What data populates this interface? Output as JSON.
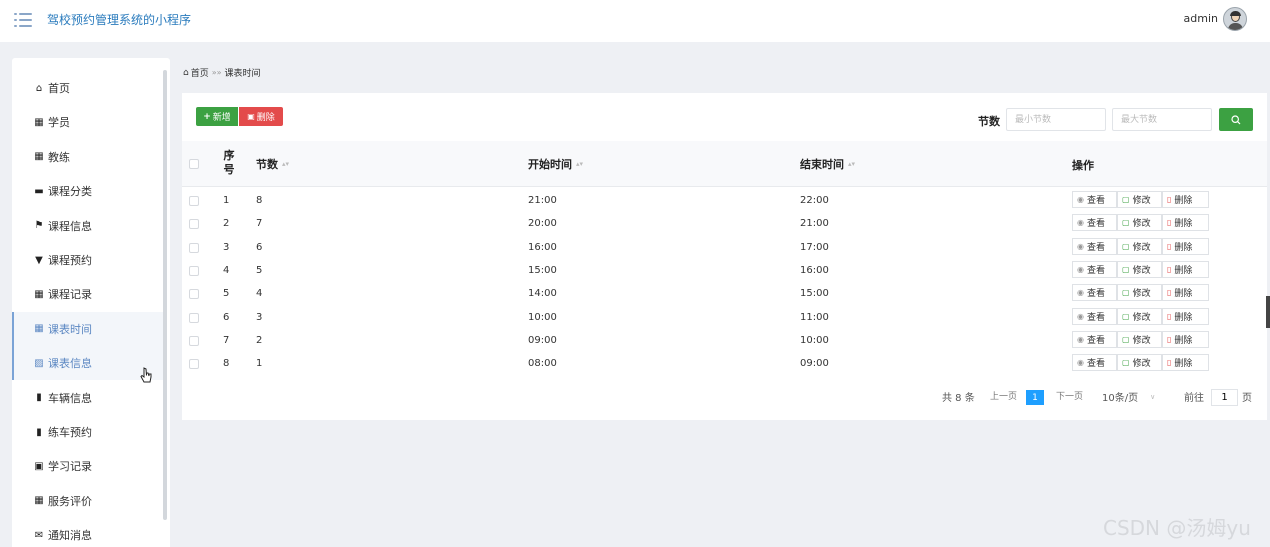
{
  "header": {
    "app_title": "驾校预约管理系统的小程序",
    "user_name": "admin"
  },
  "sidebar": {
    "items": [
      {
        "label": "首页",
        "icon": "home-icon",
        "glyph": "⌂"
      },
      {
        "label": "学员",
        "icon": "grid-icon",
        "glyph": "▦"
      },
      {
        "label": "教练",
        "icon": "grid-icon",
        "glyph": "▦"
      },
      {
        "label": "课程分类",
        "icon": "briefcase-icon",
        "glyph": "▬"
      },
      {
        "label": "课程信息",
        "icon": "flag-icon",
        "glyph": "⚑"
      },
      {
        "label": "课程预约",
        "icon": "bookmark-icon",
        "glyph": "▼"
      },
      {
        "label": "课程记录",
        "icon": "grid-icon",
        "glyph": "▦"
      },
      {
        "label": "课表时间",
        "icon": "grid-icon",
        "glyph": "▦",
        "active": true
      },
      {
        "label": "课表信息",
        "icon": "chart-icon",
        "glyph": "▨",
        "active": true
      },
      {
        "label": "车辆信息",
        "icon": "bar-chart-icon",
        "glyph": "▮"
      },
      {
        "label": "练车预约",
        "icon": "bar-chart-icon",
        "glyph": "▮"
      },
      {
        "label": "学习记录",
        "icon": "book-icon",
        "glyph": "▣"
      },
      {
        "label": "服务评价",
        "icon": "grid-icon",
        "glyph": "▦"
      },
      {
        "label": "通知消息",
        "icon": "message-icon",
        "glyph": "✉"
      }
    ]
  },
  "breadcrumb": {
    "home": "首页",
    "separator": "»»",
    "current": "课表时间"
  },
  "toolbar": {
    "add_label": "新增",
    "delete_label": "删除",
    "filter_label": "节数",
    "min_placeholder": "最小节数",
    "max_placeholder": "最大节数"
  },
  "table": {
    "headers": {
      "index": "序号",
      "section": "节数",
      "start": "开始时间",
      "end": "结束时间",
      "actions": "操作"
    },
    "action_labels": {
      "view": "查看",
      "edit": "修改",
      "delete": "删除"
    },
    "rows": [
      {
        "index": "1",
        "section": "8",
        "start": "21:00",
        "end": "22:00"
      },
      {
        "index": "2",
        "section": "7",
        "start": "20:00",
        "end": "21:00"
      },
      {
        "index": "3",
        "section": "6",
        "start": "16:00",
        "end": "17:00"
      },
      {
        "index": "4",
        "section": "5",
        "start": "15:00",
        "end": "16:00"
      },
      {
        "index": "5",
        "section": "4",
        "start": "14:00",
        "end": "15:00"
      },
      {
        "index": "6",
        "section": "3",
        "start": "10:00",
        "end": "11:00"
      },
      {
        "index": "7",
        "section": "2",
        "start": "09:00",
        "end": "10:00"
      },
      {
        "index": "8",
        "section": "1",
        "start": "08:00",
        "end": "09:00"
      }
    ]
  },
  "pagination": {
    "total": "共 8 条",
    "prev": "上一页",
    "current_page": "1",
    "next": "下一页",
    "page_size": "10条/页",
    "goto_label": "前往",
    "goto_value": "1",
    "page_suffix": "页"
  },
  "watermark": "CSDN @汤姆yu",
  "colors": {
    "accent_blue": "#2a7bbd",
    "add_green": "#3ca142",
    "delete_red": "#e34b4b",
    "page_active": "#1e9fff"
  }
}
